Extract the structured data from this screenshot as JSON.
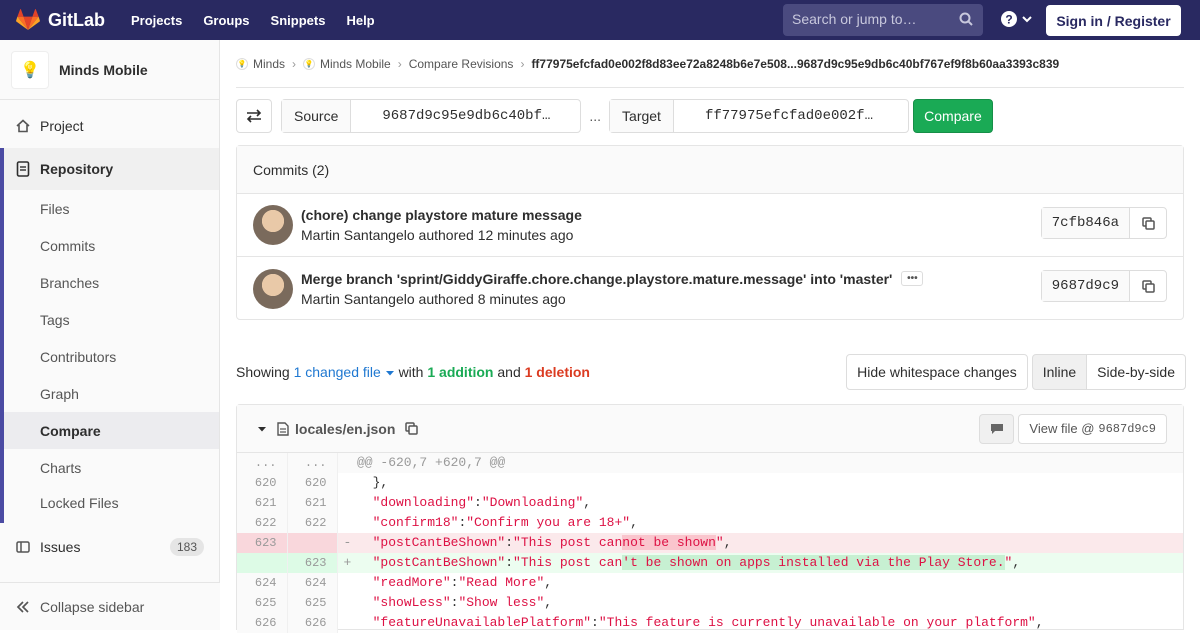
{
  "topbar": {
    "brand": "GitLab",
    "nav": [
      "Projects",
      "Groups",
      "Snippets",
      "Help"
    ],
    "search_placeholder": "Search or jump to…",
    "signin": "Sign in / Register"
  },
  "sidebar": {
    "project_name": "Minds Mobile",
    "project_avatar": "💡",
    "project_label": "Project",
    "repository_label": "Repository",
    "repo_items": [
      "Files",
      "Commits",
      "Branches",
      "Tags",
      "Contributors",
      "Graph",
      "Compare",
      "Charts",
      "Locked Files"
    ],
    "active_item": "Compare",
    "issues_label": "Issues",
    "issues_count": "183",
    "collapse_label": "Collapse sidebar"
  },
  "breadcrumb": {
    "items": [
      "Minds",
      "Minds Mobile",
      "Compare Revisions"
    ],
    "current": "ff77975efcfad0e002f8d83ee72a8248b6e7e508...9687d9c95e9db6c40bf767ef9f8b60aa3393c839"
  },
  "compare": {
    "source_label": "Source",
    "source_value": "9687d9c95e9db6c40bf…",
    "dots": "...",
    "target_label": "Target",
    "target_value": "ff77975efcfad0e002f…",
    "button": "Compare"
  },
  "commits": {
    "header": "Commits (2)",
    "list": [
      {
        "title": "(chore) change playstore mature message",
        "author": "Martin Santangelo",
        "time": "authored 12 minutes ago",
        "sha": "7cfb846a"
      },
      {
        "title": "Merge branch 'sprint/GiddyGiraffe.chore.change.playstore.mature.message' into 'master'",
        "author": "Martin Santangelo",
        "time": "authored 8 minutes ago",
        "sha": "9687d9c9"
      }
    ]
  },
  "summary": {
    "showing": "Showing",
    "changed": "1 changed file",
    "with": "with",
    "additions": "1 addition",
    "and": "and",
    "deletions": "1 deletion",
    "hide_ws": "Hide whitespace changes",
    "inline": "Inline",
    "side_by_side": "Side-by-side"
  },
  "file": {
    "name": "locales/en.json",
    "view_file": "View file @",
    "view_sha": "9687d9c9",
    "hunk": "@@ -620,7 +620,7 @@",
    "lines": [
      {
        "type": "ctx",
        "old": "620",
        "new": "620",
        "code": "  },"
      },
      {
        "type": "ctx",
        "old": "621",
        "new": "621",
        "key": "\"downloading\"",
        "val": "\"Downloading\""
      },
      {
        "type": "ctx",
        "old": "622",
        "new": "622",
        "key": "\"confirm18\"",
        "val": "\"Confirm you are 18+\""
      },
      {
        "type": "old",
        "old": "623",
        "new": "",
        "sign": "-",
        "key": "\"postCantBeShown\"",
        "pre": "\"This post can",
        "hl": "not be shown",
        "post": "\""
      },
      {
        "type": "new",
        "old": "",
        "new": "623",
        "sign": "+",
        "key": "\"postCantBeShown\"",
        "pre": "\"This post can",
        "hl": "'t be shown on apps installed via the Play Store.",
        "post": "\""
      },
      {
        "type": "ctx",
        "old": "624",
        "new": "624",
        "key": "\"readMore\"",
        "val": "\"Read More\""
      },
      {
        "type": "ctx",
        "old": "625",
        "new": "625",
        "key": "\"showLess\"",
        "val": "\"Show less\""
      },
      {
        "type": "ctx",
        "old": "626",
        "new": "626",
        "key": "\"featureUnavailablePlatform\"",
        "val": "\"This feature is currently unavailable on your platform\""
      }
    ]
  },
  "colors": {
    "topbar": "#292961",
    "accent": "#4b4ba3",
    "compare_button": "#1aaa55",
    "addition": "#1aaa55",
    "deletion": "#db3b21"
  }
}
